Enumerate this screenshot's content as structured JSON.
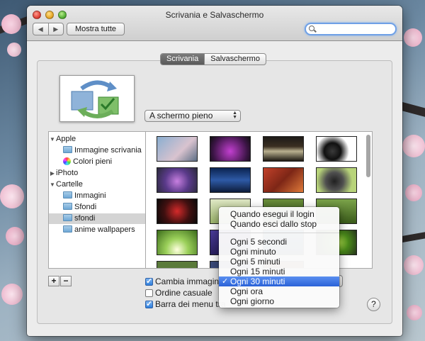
{
  "window": {
    "title": "Scrivania e Salvaschermo",
    "nav_back": "◀",
    "nav_forward": "▶",
    "show_all_label": "Mostra tutte",
    "search": {
      "placeholder": "",
      "value": ""
    }
  },
  "tabs": [
    {
      "label": "Scrivania",
      "active": true
    },
    {
      "label": "Salvaschermo",
      "active": false
    }
  ],
  "picture_mode": {
    "selected": "A schermo pieno"
  },
  "sidebar": {
    "apple": {
      "label": "Apple",
      "items": [
        {
          "label": "Immagine scrivania"
        },
        {
          "label": "Colori pieni"
        }
      ]
    },
    "iphoto": {
      "label": "iPhoto"
    },
    "folders": {
      "label": "Cartelle",
      "items": [
        {
          "label": "Immagini"
        },
        {
          "label": "Sfondi"
        },
        {
          "label": "sfondi",
          "selected": true
        },
        {
          "label": "anime wallpapers"
        }
      ]
    }
  },
  "list_buttons": {
    "add": "+",
    "remove": "−"
  },
  "options": {
    "change_picture": {
      "label": "Cambia immagine",
      "checked": true
    },
    "random_order": {
      "label": "Ordine casuale",
      "checked": false
    },
    "menu_bar": {
      "label": "Barra dei menu tra",
      "checked": true
    }
  },
  "interval_menu": {
    "items_top": [
      "Quando esegui il login",
      "Quando esci dallo stop"
    ],
    "items_bottom": [
      "Ogni 5 secondi",
      "Ogni minuto",
      "Ogni 5 minuti",
      "Ogni 15 minuti",
      "Ogni 30 minuti",
      "Ogni ora",
      "Ogni giorno"
    ],
    "selected": "Ogni 30 minuti",
    "check_mark": "✓"
  },
  "help_label": "?"
}
